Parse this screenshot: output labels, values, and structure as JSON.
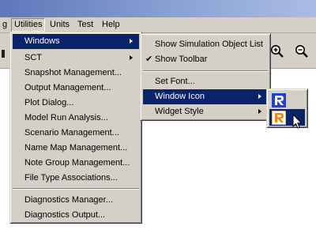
{
  "menubar": {
    "items": [
      {
        "label": "g"
      },
      {
        "label": "Utilities"
      },
      {
        "label": "Units"
      },
      {
        "label": "Test"
      },
      {
        "label": "Help"
      }
    ]
  },
  "utilities_menu": {
    "items": [
      {
        "label": "Windows"
      },
      {
        "label": "SCT"
      },
      {
        "label": "Snapshot Management..."
      },
      {
        "label": "Output Management..."
      },
      {
        "label": "Plot Dialog..."
      },
      {
        "label": "Model Run Analysis..."
      },
      {
        "label": "Scenario Management..."
      },
      {
        "label": "Name Map Management..."
      },
      {
        "label": "Note Group Management..."
      },
      {
        "label": "File Type Associations..."
      },
      {
        "label": "Diagnostics Manager..."
      },
      {
        "label": "Diagnostics Output..."
      }
    ]
  },
  "windows_menu": {
    "items": [
      {
        "label": "Show Simulation Object List"
      },
      {
        "label": "Show Toolbar",
        "checked": true
      },
      {
        "label": "Set Font..."
      },
      {
        "label": "Window Icon"
      },
      {
        "label": "Widget Style"
      }
    ],
    "check_glyph": "✔"
  },
  "window_icon_menu": {
    "options": [
      {
        "icon": "blue-r-logo-icon"
      },
      {
        "icon": "orange-r-logo-icon"
      }
    ]
  },
  "toolbar": {
    "icons": [
      "zoom-in-icon",
      "zoom-out-icon"
    ]
  },
  "colors": {
    "menu_bg": "#d4d0c8",
    "highlight": "#0a246a",
    "titlebar_start": "#5c78b8",
    "titlebar_end": "#a9bde3"
  }
}
